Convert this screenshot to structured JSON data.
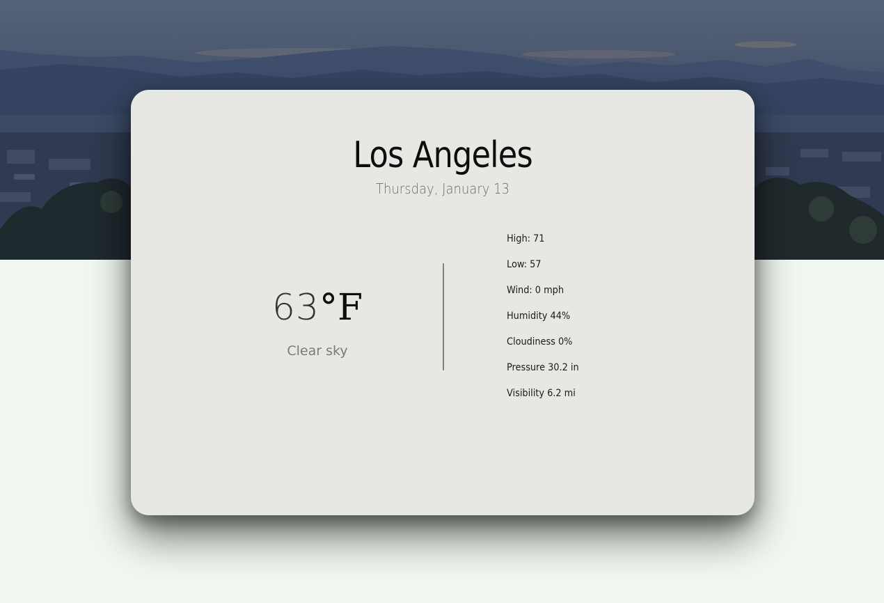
{
  "location": {
    "city": "Los Angeles",
    "date": "Thursday, January 13"
  },
  "current": {
    "temperature": "63",
    "unit": "°F",
    "description": "Clear sky"
  },
  "details": [
    {
      "label": "High: 71"
    },
    {
      "label": "Low: 57"
    },
    {
      "label": "Wind: 0 mph"
    },
    {
      "label": "Humidity 44%"
    },
    {
      "label": "Cloudiness 0%"
    },
    {
      "label": "Pressure 30.2 in"
    },
    {
      "label": "Visibility 6.2 mi"
    }
  ],
  "colors": {
    "background": "#f0f8f0",
    "card": "#e7e7e3",
    "hero_sky": "#566276",
    "text": "#0d0d0d",
    "muted_text": "#6c6c6c"
  }
}
